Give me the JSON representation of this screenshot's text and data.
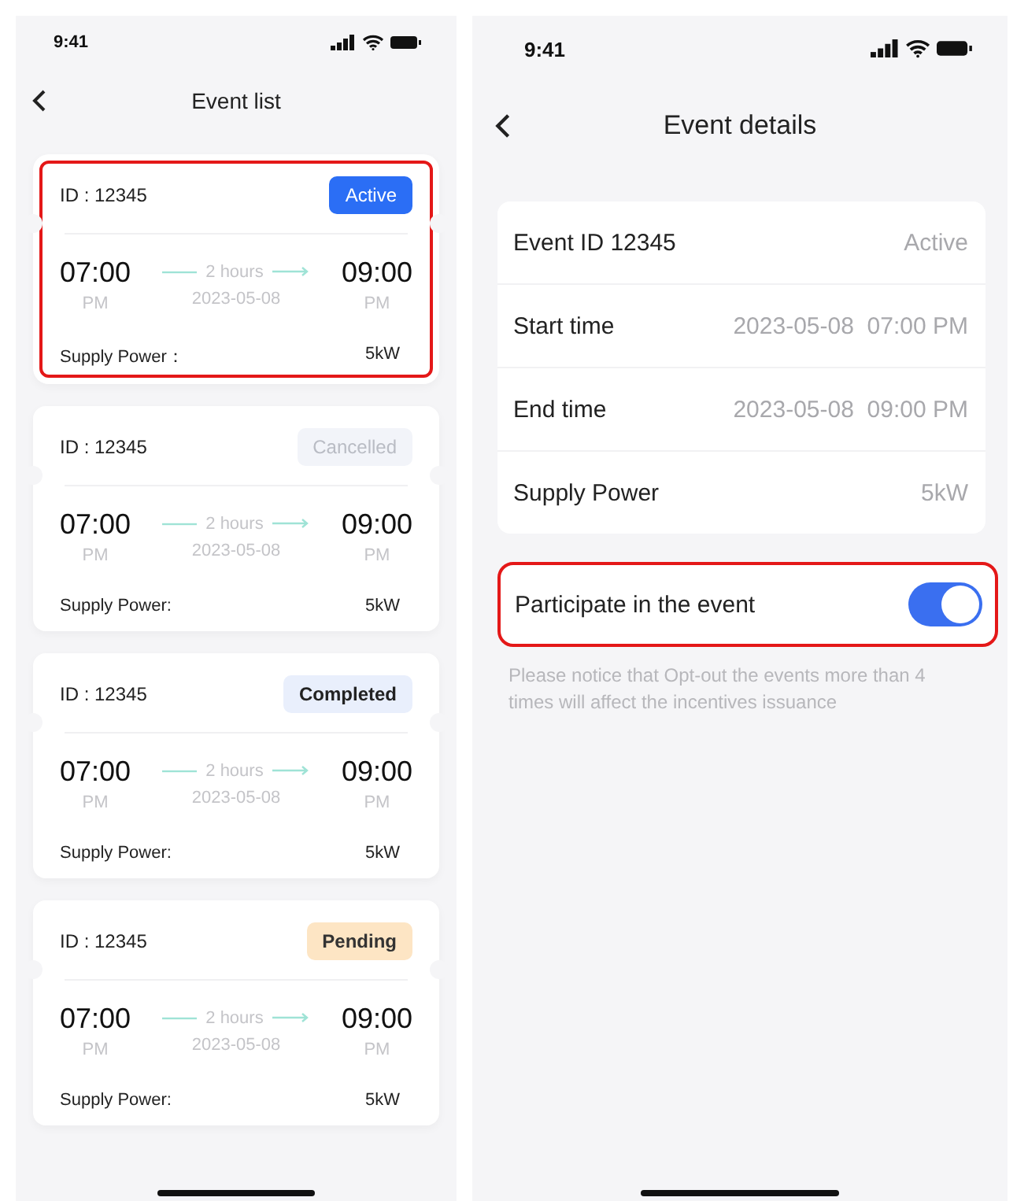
{
  "list_screen": {
    "status_bar": {
      "time": "9:41"
    },
    "nav": {
      "title": "Event list"
    },
    "events": [
      {
        "id": "ID : 12345",
        "status": {
          "label": "Active",
          "kind": "active"
        },
        "highlighted": true,
        "start": "07:00",
        "start_period": "PM",
        "duration": "2 hours",
        "date": "2023-05-08",
        "end": "09:00",
        "end_period": "PM",
        "power_label": "Supply Power：",
        "power": "5kW"
      },
      {
        "id": "ID : 12345",
        "status": {
          "label": "Cancelled",
          "kind": "cancelled"
        },
        "highlighted": false,
        "start": "07:00",
        "start_period": "PM",
        "duration": "2 hours",
        "date": "2023-05-08",
        "end": "09:00",
        "end_period": "PM",
        "power_label": "Supply Power:",
        "power": "5kW"
      },
      {
        "id": "ID : 12345",
        "status": {
          "label": "Completed",
          "kind": "completed"
        },
        "highlighted": false,
        "start": "07:00",
        "start_period": "PM",
        "duration": "2 hours",
        "date": "2023-05-08",
        "end": "09:00",
        "end_period": "PM",
        "power_label": "Supply Power:",
        "power": "5kW"
      },
      {
        "id": "ID : 12345",
        "status": {
          "label": "Pending",
          "kind": "pending"
        },
        "highlighted": false,
        "start": "07:00",
        "start_period": "PM",
        "duration": "2 hours",
        "date": "2023-05-08",
        "end": "09:00",
        "end_period": "PM",
        "power_label": "Supply Power:",
        "power": "5kW"
      }
    ]
  },
  "detail_screen": {
    "status_bar": {
      "time": "9:41"
    },
    "nav": {
      "title": "Event details"
    },
    "rows": [
      {
        "label": "Event ID 12345",
        "value": "Active"
      },
      {
        "label": "Start time",
        "value": "2023-05-08  07:00 PM"
      },
      {
        "label": "End time",
        "value": "2023-05-08  09:00 PM"
      },
      {
        "label": "Supply Power",
        "value": "5kW"
      }
    ],
    "participate": {
      "label": "Participate in the event",
      "on": true,
      "highlighted": true
    },
    "notice": "Please notice that Opt-out the events more than 4 times will affect the incentives issuance"
  }
}
